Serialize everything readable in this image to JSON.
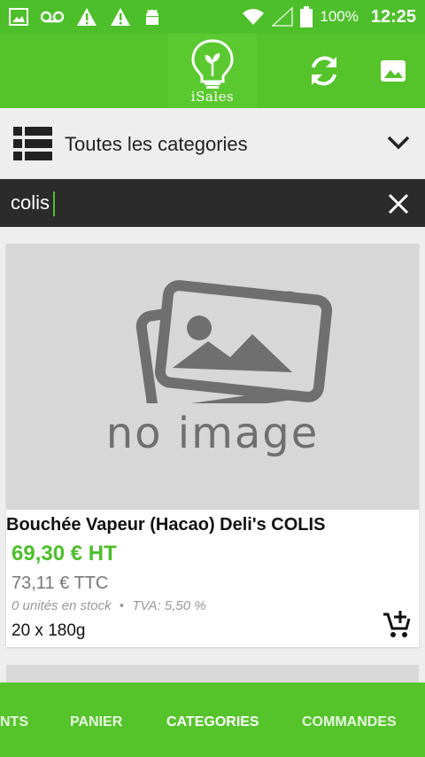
{
  "status_bar": {
    "battery": "100%",
    "time": "12:25"
  },
  "app_bar": {
    "logo_text": "iSales",
    "refresh_icon": "refresh-icon",
    "image_icon": "image-icon"
  },
  "category_selector": {
    "label": "Toutes les categories"
  },
  "search": {
    "value": "colis"
  },
  "product": {
    "name": "Bouchée Vapeur (Hacao) Deli's COLIS",
    "price_ht": "69,30 € HT",
    "price_ttc": "73,11 € TTC",
    "stock": "0 unités en stock",
    "separator": "•",
    "tva": "TVA: 5,50 %",
    "pack": "20 x 180g",
    "image_placeholder": "no image"
  },
  "bottom_nav": {
    "items": [
      {
        "label": "NTS"
      },
      {
        "label": "PANIER"
      },
      {
        "label": "CATEGORIES"
      },
      {
        "label": "COMMANDES"
      }
    ]
  },
  "colors": {
    "primary": "#55c42b",
    "status_bar": "#4cbf2a",
    "price_ht": "#4cbf2a",
    "search_bar": "#2b2b2b"
  }
}
